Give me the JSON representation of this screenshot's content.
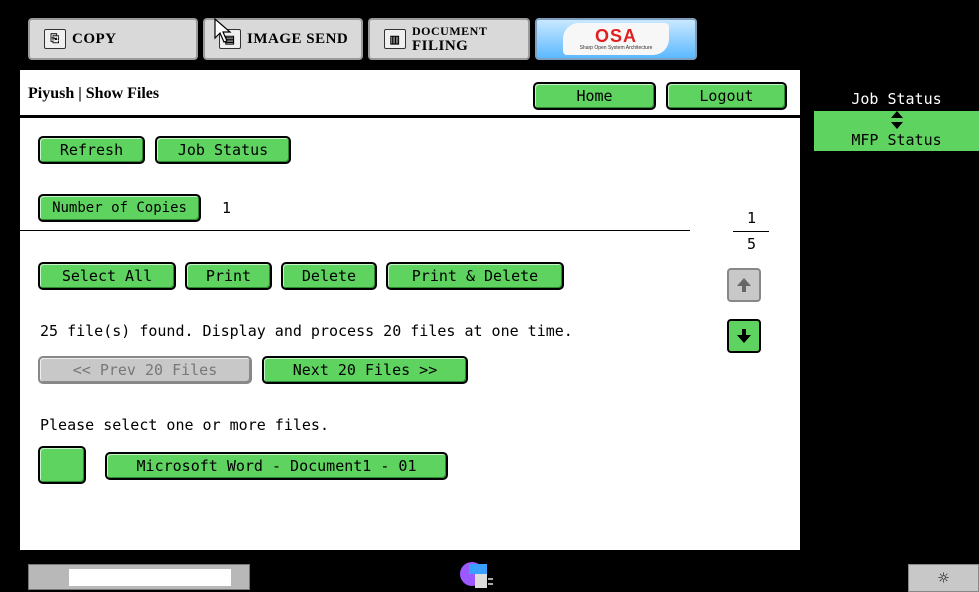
{
  "mode_tabs": [
    {
      "label": "COPY",
      "icon": "copy-icon"
    },
    {
      "label": "IMAGE SEND",
      "icon": "image-send-icon"
    },
    {
      "label_line1": "DOCUMENT",
      "label_line2": "FILING",
      "icon": "document-filing-icon"
    }
  ],
  "osa": {
    "logo_text": "OSA",
    "tagline": "Sharp Open System Architecture"
  },
  "header": {
    "title": "Piyush | Show Files",
    "home_label": "Home",
    "logout_label": "Logout"
  },
  "toolbar": {
    "refresh_label": "Refresh",
    "job_status_label": "Job Status"
  },
  "copies": {
    "button_label": "Number of Copies",
    "value": "1"
  },
  "pager": {
    "current": "1",
    "total": "5"
  },
  "actions": {
    "select_all": "Select All",
    "print": "Print",
    "delete": "Delete",
    "print_delete": "Print & Delete"
  },
  "info_text": "25 file(s) found. Display and process 20 files at one time.",
  "nav": {
    "prev_label": "<< Prev 20 Files",
    "next_label": "Next 20 Files >>"
  },
  "select_prompt": "Please select one or more files.",
  "files": [
    {
      "name": "Microsoft Word - Document1 - 01"
    }
  ],
  "status_panel": {
    "job_status": "Job Status",
    "mfp_status": "MFP Status"
  },
  "colors": {
    "accent_green": "#5fd35f",
    "osa_blue": "#5cb9ff"
  }
}
